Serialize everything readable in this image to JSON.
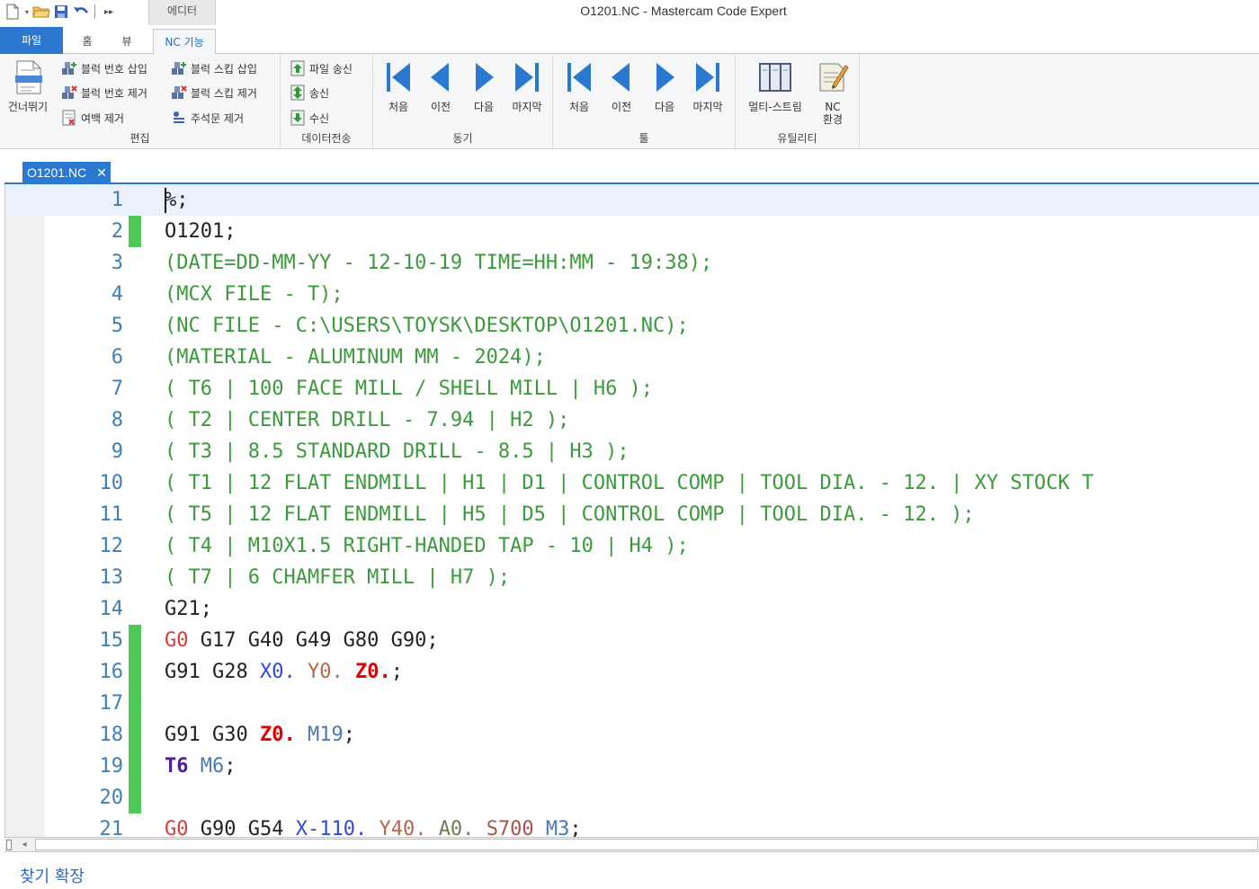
{
  "window": {
    "title": "O1201.NC - Mastercam Code Expert",
    "context_tab": "에디터"
  },
  "tabs": [
    {
      "label": "파일"
    },
    {
      "label": "홈"
    },
    {
      "label": "뷰"
    },
    {
      "label": "NC 기능"
    }
  ],
  "ribbon": {
    "skip_label": "건너뛰기",
    "edit": {
      "label": "편집",
      "insert_block_number": "블럭 번호 삽입",
      "remove_block_number": "블럭 번호 제거",
      "remove_spaces": "여백 제거",
      "insert_block_skip": "블럭 스킵 삽입",
      "remove_block_skip": "블럭 스킵 제거",
      "remove_comments": "주석문 제거"
    },
    "transfer": {
      "label": "데이터전송",
      "send_file": "파일 송신",
      "send": "송신",
      "receive": "수신"
    },
    "sync": {
      "label": "동기",
      "first": "처음",
      "prev": "이전",
      "next": "다음",
      "last": "마지막"
    },
    "tool": {
      "label": "툴",
      "first": "처음",
      "prev": "이전",
      "next": "다음",
      "last": "마지막"
    },
    "utility": {
      "label": "유틸리티",
      "multi_stream": "멀티-스트림",
      "nc_env_line1": "NC",
      "nc_env_line2": "환경"
    }
  },
  "document": {
    "tab_name": "O1201.NC",
    "close_glyph": "✕"
  },
  "editor": {
    "lines": [
      {
        "n": "1",
        "mark": false,
        "tokens": [
          {
            "t": "%;",
            "c": "plain"
          }
        ]
      },
      {
        "n": "2",
        "mark": true,
        "tokens": [
          {
            "t": "O1201;",
            "c": "plain"
          }
        ]
      },
      {
        "n": "3",
        "mark": false,
        "tokens": [
          {
            "t": "(DATE=DD-MM-YY - 12-10-19 TIME=HH:MM - 19:38);",
            "c": "comment"
          }
        ]
      },
      {
        "n": "4",
        "mark": false,
        "tokens": [
          {
            "t": "(MCX FILE - T);",
            "c": "comment"
          }
        ]
      },
      {
        "n": "5",
        "mark": false,
        "tokens": [
          {
            "t": "(NC FILE - C:\\USERS\\TOYSK\\DESKTOP\\O1201.NC);",
            "c": "comment"
          }
        ]
      },
      {
        "n": "6",
        "mark": false,
        "tokens": [
          {
            "t": "(MATERIAL - ALUMINUM MM - 2024);",
            "c": "comment"
          }
        ]
      },
      {
        "n": "7",
        "mark": false,
        "tokens": [
          {
            "t": "( T6 | 100 FACE MILL / SHELL MILL | H6 );",
            "c": "comment"
          }
        ]
      },
      {
        "n": "8",
        "mark": false,
        "tokens": [
          {
            "t": "( T2 | CENTER DRILL - 7.94 | H2 );",
            "c": "comment"
          }
        ]
      },
      {
        "n": "9",
        "mark": false,
        "tokens": [
          {
            "t": "( T3 | 8.5 STANDARD DRILL - 8.5 | H3 );",
            "c": "comment"
          }
        ]
      },
      {
        "n": "10",
        "mark": false,
        "tokens": [
          {
            "t": "( T1 | 12 FLAT ENDMILL | H1 | D1 | CONTROL COMP | TOOL DIA. - 12. | XY STOCK T",
            "c": "comment"
          }
        ]
      },
      {
        "n": "11",
        "mark": false,
        "tokens": [
          {
            "t": "( T5 | 12 FLAT ENDMILL | H5 | D5 | CONTROL COMP | TOOL DIA. - 12. );",
            "c": "comment"
          }
        ]
      },
      {
        "n": "12",
        "mark": false,
        "tokens": [
          {
            "t": "( T4 | M10X1.5 RIGHT-HANDED TAP - 10 | H4 );",
            "c": "comment"
          }
        ]
      },
      {
        "n": "13",
        "mark": false,
        "tokens": [
          {
            "t": "( T7 | 6 CHAMFER MILL | H7 );",
            "c": "comment"
          }
        ]
      },
      {
        "n": "14",
        "mark": false,
        "tokens": [
          {
            "t": "G21;",
            "c": "plain"
          }
        ]
      },
      {
        "n": "15",
        "mark": true,
        "tokens": [
          {
            "t": "G0",
            "c": "g0"
          },
          {
            "t": " G17 G40 G49 G80 G90;",
            "c": "plain"
          }
        ]
      },
      {
        "n": "16",
        "mark": true,
        "tokens": [
          {
            "t": "G91 G28 ",
            "c": "plain"
          },
          {
            "t": "X0.",
            "c": "x"
          },
          {
            "t": " ",
            "c": "plain"
          },
          {
            "t": "Y0.",
            "c": "y"
          },
          {
            "t": " ",
            "c": "plain"
          },
          {
            "t": "Z0.",
            "c": "z"
          },
          {
            "t": ";",
            "c": "plain"
          }
        ]
      },
      {
        "n": "17",
        "mark": true,
        "tokens": []
      },
      {
        "n": "18",
        "mark": true,
        "tokens": [
          {
            "t": "G91 G30 ",
            "c": "plain"
          },
          {
            "t": "Z0.",
            "c": "z"
          },
          {
            "t": " ",
            "c": "plain"
          },
          {
            "t": "M19",
            "c": "m"
          },
          {
            "t": ";",
            "c": "plain"
          }
        ]
      },
      {
        "n": "19",
        "mark": true,
        "tokens": [
          {
            "t": "T6",
            "c": "t"
          },
          {
            "t": " ",
            "c": "plain"
          },
          {
            "t": "M6",
            "c": "m"
          },
          {
            "t": ";",
            "c": "plain"
          }
        ]
      },
      {
        "n": "20",
        "mark": true,
        "tokens": []
      },
      {
        "n": "21",
        "mark": false,
        "tokens": [
          {
            "t": "G0",
            "c": "g0"
          },
          {
            "t": " G90 G54 ",
            "c": "plain"
          },
          {
            "t": "X-110.",
            "c": "x"
          },
          {
            "t": " ",
            "c": "plain"
          },
          {
            "t": "Y40.",
            "c": "y"
          },
          {
            "t": " ",
            "c": "plain"
          },
          {
            "t": "A0.",
            "c": "a"
          },
          {
            "t": " ",
            "c": "plain"
          },
          {
            "t": "S700",
            "c": "s"
          },
          {
            "t": " ",
            "c": "plain"
          },
          {
            "t": "M3",
            "c": "m"
          },
          {
            "t": ";",
            "c": "plain"
          }
        ]
      }
    ],
    "current_line": "1"
  },
  "bottom": {
    "find_expand": "찾기 확장"
  },
  "colors": {
    "accent": "#2b78d0",
    "marker": "#4fc85a",
    "comment": "#3b9a3b"
  }
}
